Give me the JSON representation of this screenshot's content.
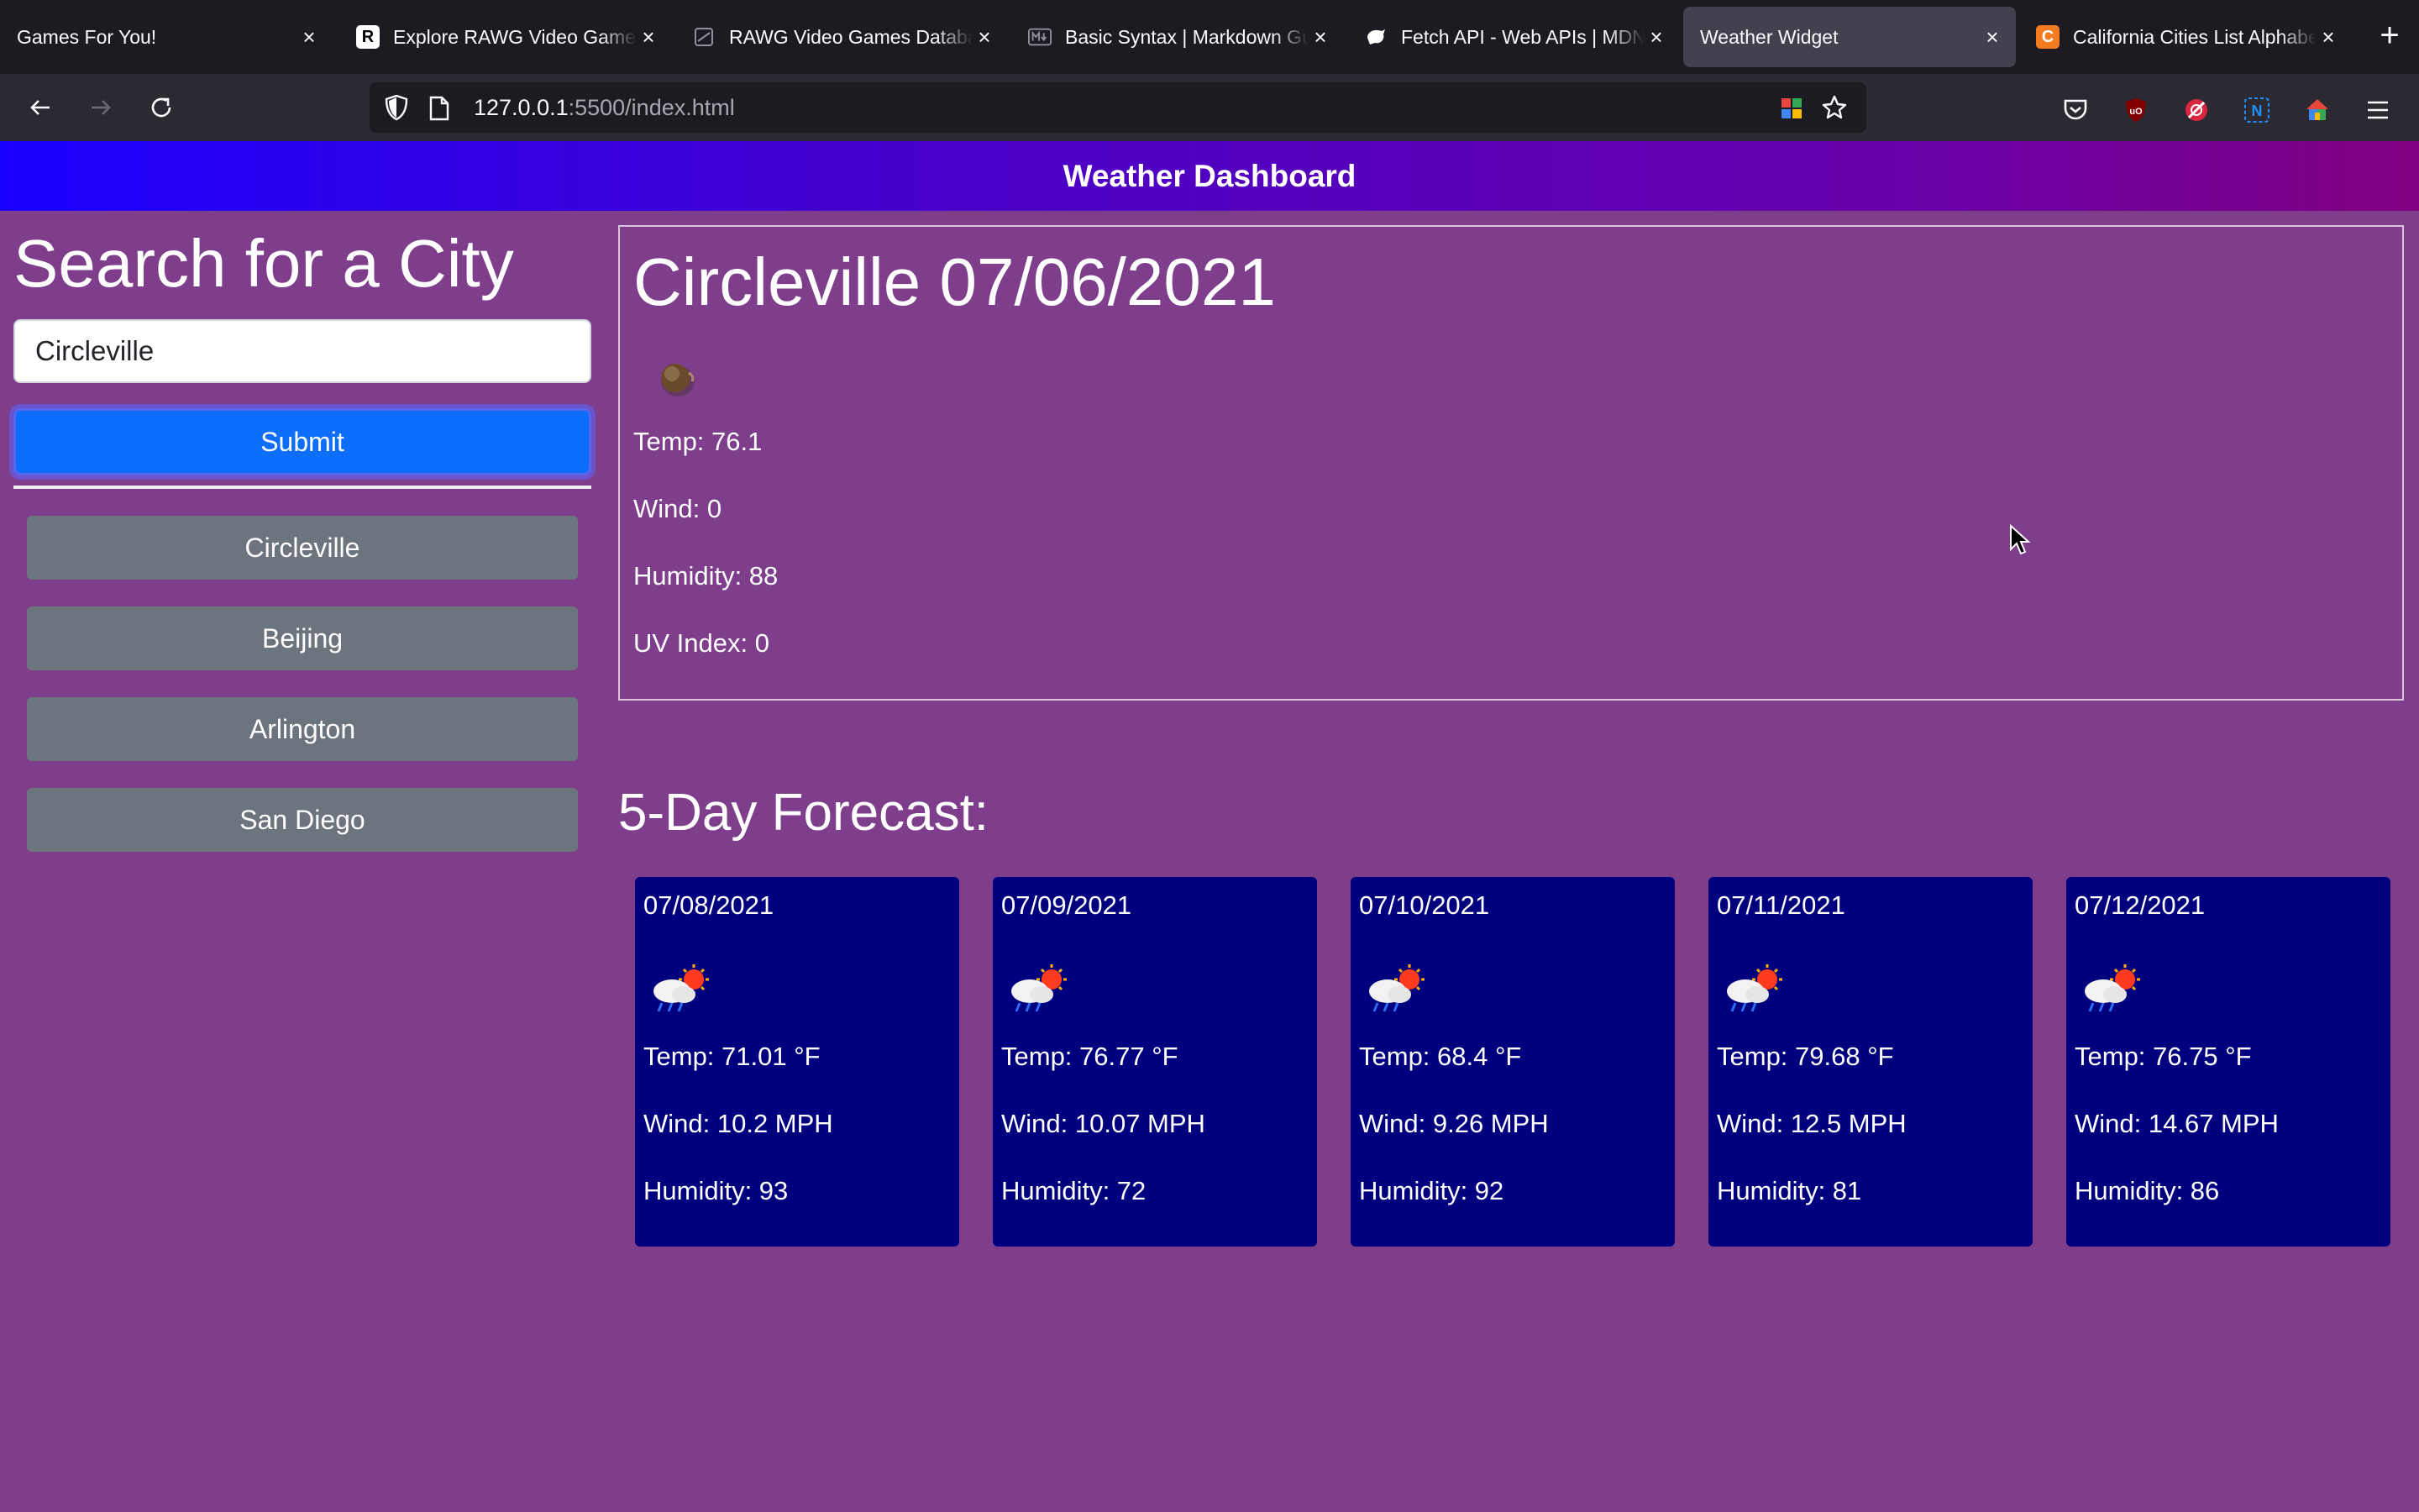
{
  "browser": {
    "tabs": [
      {
        "title": "Games For You!",
        "favicon": "none",
        "active": false
      },
      {
        "title": "Explore RAWG Video Games",
        "favicon": "rawg-logo-icon",
        "active": false
      },
      {
        "title": "RAWG Video Games Database",
        "favicon": "rawg-api-icon",
        "active": false
      },
      {
        "title": "Basic Syntax | Markdown Guide",
        "favicon": "markdown-icon",
        "active": false
      },
      {
        "title": "Fetch API - Web APIs | MDN",
        "favicon": "mdn-icon",
        "active": false
      },
      {
        "title": "Weather Widget",
        "favicon": "none",
        "active": true
      },
      {
        "title": "California Cities List Alphabetical",
        "favicon": "orange-c-icon",
        "active": false
      }
    ],
    "url_host": "127.0.0.1",
    "url_rest": ":5500/index.html"
  },
  "header": {
    "title": "Weather Dashboard"
  },
  "search": {
    "heading": "Search for a City",
    "input_value": "Circleville",
    "submit_label": "Submit"
  },
  "history": [
    "Circleville",
    "Beijing",
    "Arlington",
    "San Diego"
  ],
  "current": {
    "title": "Circleville 07/06/2021",
    "icon": "clear-night-moon-icon",
    "temp": "Temp: 76.1",
    "wind": "Wind: 0",
    "humidity": "Humidity: 88",
    "uv": "UV Index: 0"
  },
  "forecast": {
    "title": "5-Day Forecast:",
    "days": [
      {
        "date": "07/08/2021",
        "icon": "rain-sun-cloud-icon",
        "temp": "Temp: 71.01 °F",
        "wind": "Wind: 10.2 MPH",
        "humidity": "Humidity: 93"
      },
      {
        "date": "07/09/2021",
        "icon": "rain-sun-cloud-icon",
        "temp": "Temp: 76.77 °F",
        "wind": "Wind: 10.07 MPH",
        "humidity": "Humidity: 72"
      },
      {
        "date": "07/10/2021",
        "icon": "rain-sun-cloud-icon",
        "temp": "Temp: 68.4 °F",
        "wind": "Wind: 9.26 MPH",
        "humidity": "Humidity: 92"
      },
      {
        "date": "07/11/2021",
        "icon": "rain-sun-cloud-icon",
        "temp": "Temp: 79.68 °F",
        "wind": "Wind: 12.5 MPH",
        "humidity": "Humidity: 81"
      },
      {
        "date": "07/12/2021",
        "icon": "rain-sun-cloud-icon",
        "temp": "Temp: 76.75 °F",
        "wind": "Wind: 14.67 MPH",
        "humidity": "Humidity: 86"
      }
    ]
  }
}
